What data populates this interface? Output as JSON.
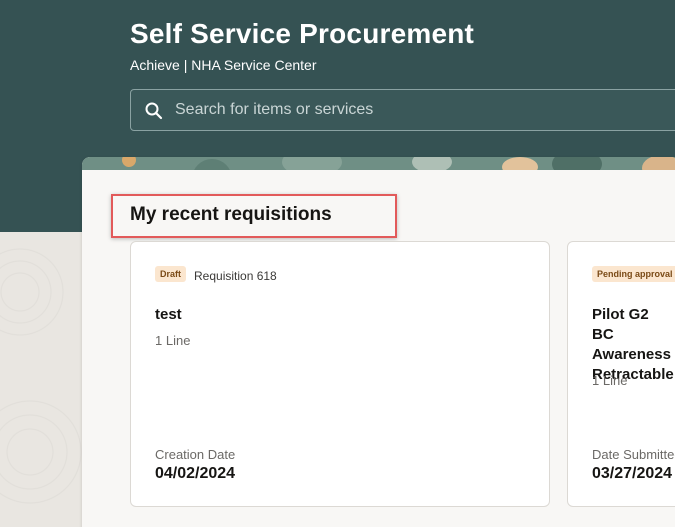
{
  "header": {
    "title": "Self Service Procurement",
    "subtitle": "Achieve | NHA Service Center"
  },
  "search": {
    "placeholder": "Search for items or services",
    "value": ""
  },
  "recent": {
    "section_title": "My recent requisitions",
    "cards": [
      {
        "status": "Draft",
        "number": "Requisition 618",
        "title": "test",
        "lines": "1 Line",
        "date_label": "Creation Date",
        "date_value": "04/02/2024"
      },
      {
        "status": "Pending approval",
        "number": "",
        "title": "Pilot G2 BC Awareness Retractable",
        "lines": "1 Line",
        "date_label": "Date Submitted",
        "date_value": "03/27/2024"
      }
    ]
  },
  "colors": {
    "header_bg": "#355253",
    "highlight": "#e25a5a",
    "badge_bg": "#fbe6cf"
  },
  "icons": {
    "search": "search-icon"
  }
}
